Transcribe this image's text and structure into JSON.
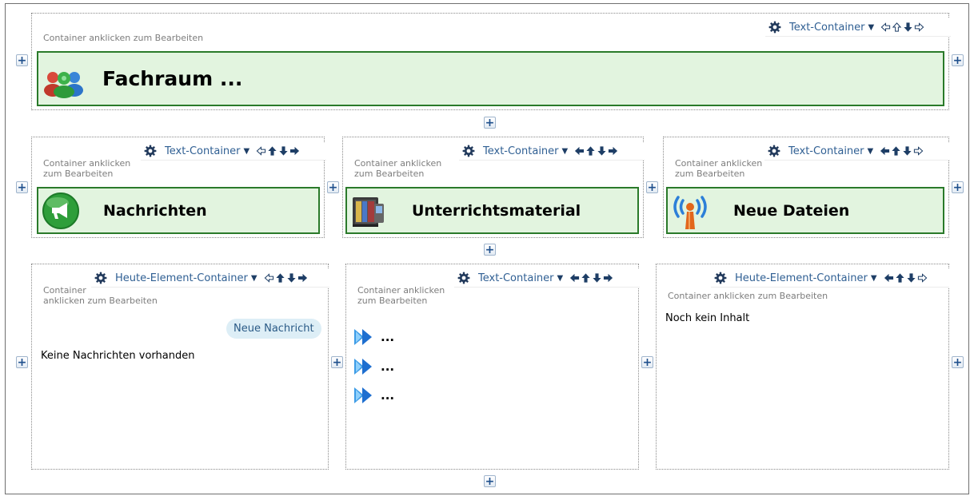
{
  "common": {
    "hint_full": "Container anklicken zum Bearbeiten",
    "hint_line1": "Container anklicken",
    "hint_line2": "zum Bearbeiten",
    "hint_l1_short": "Container",
    "hint_l2_long": "anklicken zum Bearbeiten",
    "plus": "+"
  },
  "top": {
    "toolbar_label": "Text-Container",
    "banner_title": "Fachraum ..."
  },
  "row2": {
    "left": {
      "toolbar_label": "Text-Container",
      "banner_title": "Nachrichten"
    },
    "middle": {
      "toolbar_label": "Text-Container",
      "banner_title": "Unterrichtsmaterial"
    },
    "right": {
      "toolbar_label": "Text-Container",
      "banner_title": "Neue Dateien"
    }
  },
  "row3": {
    "left": {
      "toolbar_label": "Heute-Element-Container",
      "button_label": "Neue Nachricht",
      "empty_text": "Keine Nachrichten vorhanden"
    },
    "middle": {
      "toolbar_label": "Text-Container",
      "links": [
        "...",
        "...",
        "..."
      ]
    },
    "right": {
      "toolbar_label": "Heute-Element-Container",
      "empty_text": "Noch kein Inhalt"
    }
  },
  "colors": {
    "banner_bg": "#e2f4df",
    "banner_border": "#2a7a2a",
    "toolbar_text": "#2f5f93",
    "pill_bg": "#ddeef6"
  },
  "icons": {
    "gear": "gear-icon",
    "move_left": "arrow-left-icon",
    "move_up": "arrow-up-icon",
    "move_down": "arrow-down-icon",
    "move_right": "arrow-right-icon",
    "add": "plus-icon",
    "group": "user-group-icon",
    "announce": "megaphone-icon",
    "material": "books-icon",
    "files": "broadcast-icon",
    "forward": "double-arrow-icon"
  }
}
